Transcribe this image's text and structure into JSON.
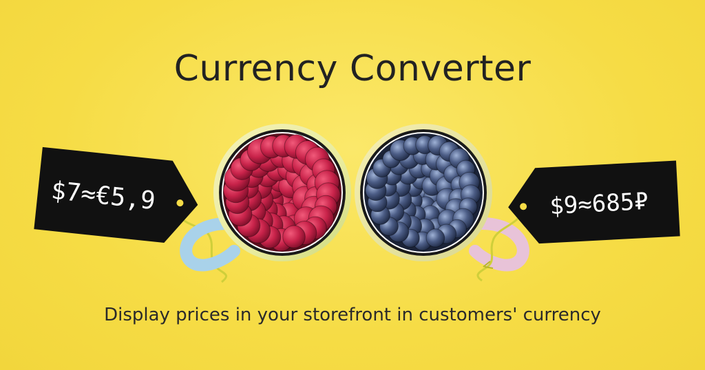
{
  "header": {
    "title": "Currency Converter"
  },
  "tags": {
    "left_price": "$7≈€5,9",
    "right_price": "$9≈685₽"
  },
  "footer": {
    "subtitle": "Display prices in your storefront in customers' currency"
  },
  "colors": {
    "background": "#f7e04f",
    "tag": "#111111",
    "raspberry": "#c8234a",
    "blueberry": "#4c5d86",
    "mug_left": "#a9d2ea",
    "mug_right": "#e8c3d8"
  },
  "icons": [
    "raspberry-mug",
    "blueberry-mug",
    "price-tag"
  ]
}
